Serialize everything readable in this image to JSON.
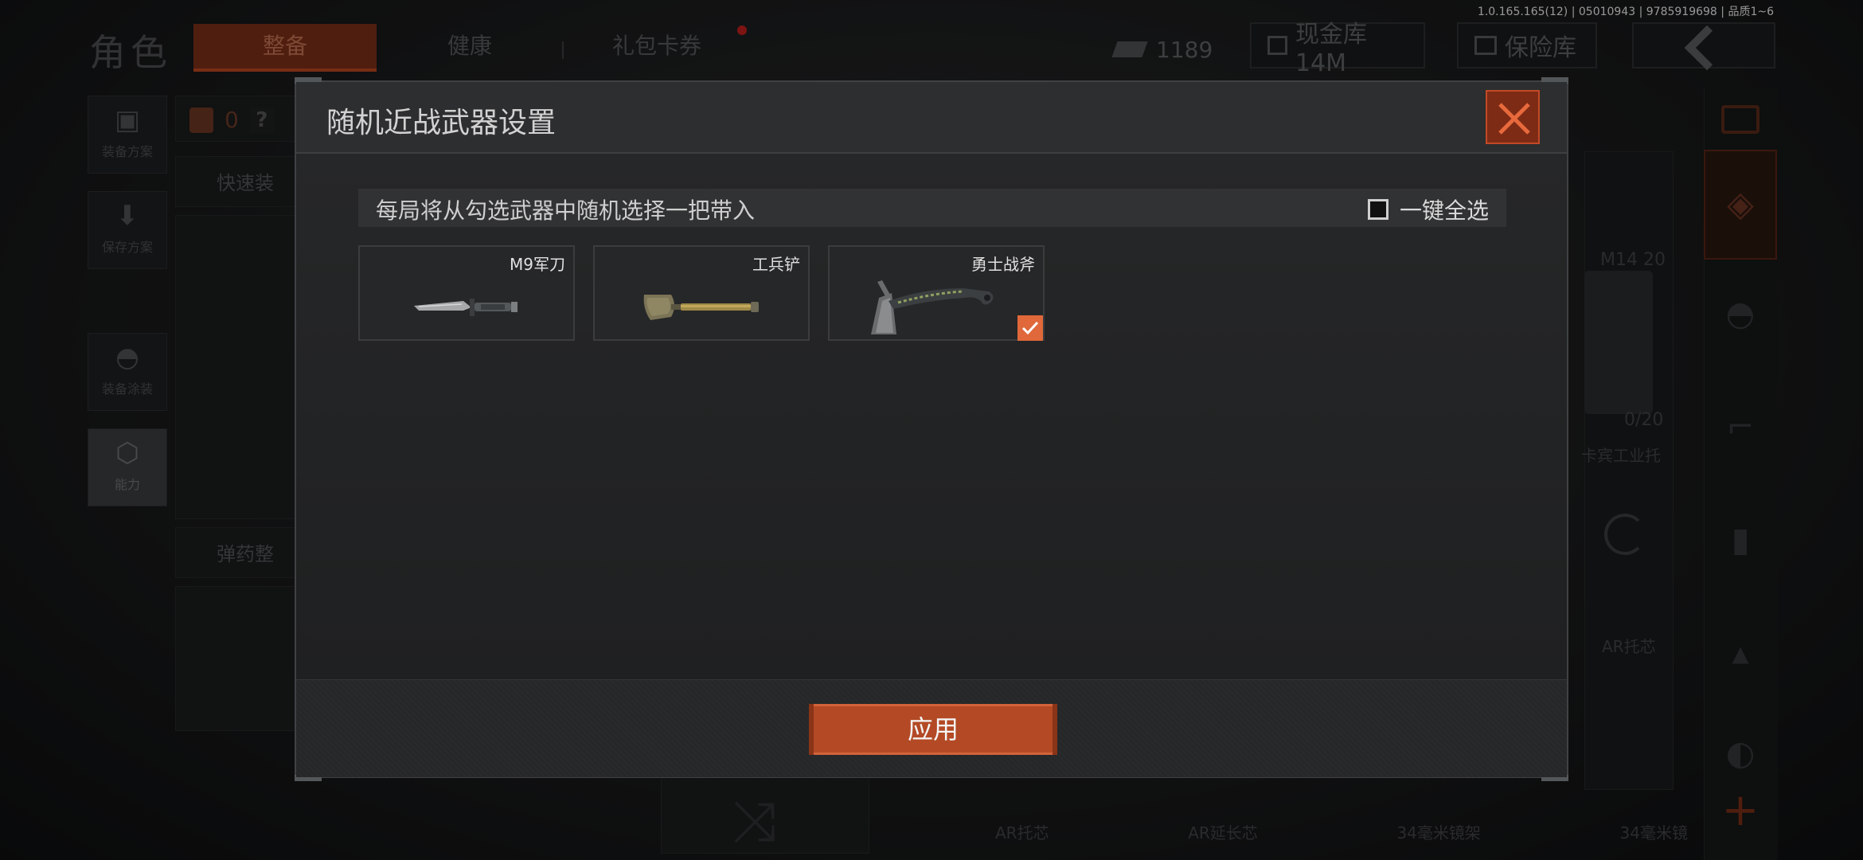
{
  "build_info": "1.0.165.165(12) | 05010943 | 9785919698 | 品质1~6",
  "header": {
    "title": "角色",
    "tabs": [
      {
        "label": "整备",
        "active": true
      },
      {
        "label": "健康",
        "active": false
      },
      {
        "label": "礼包卡券",
        "active": false
      }
    ],
    "currency": "1189",
    "cash_vault": "现金库 14M",
    "safe_box": "保险库"
  },
  "left_nav": [
    {
      "label": "装备方案",
      "icon": "vest-icon"
    },
    {
      "label": "保存方案",
      "icon": "download-icon"
    },
    {
      "label": "装备涂装",
      "icon": "helmet-icon"
    },
    {
      "label": "能力",
      "icon": "ability-icon",
      "active": true
    }
  ],
  "loadout": {
    "armor_count": "0",
    "help": "?",
    "quick_equip": "快速装",
    "ammo_config": "弹药整"
  },
  "attachments": {
    "mag_name": "M14 20",
    "mag_count": "0/20",
    "stock_name": "卡宾工业托",
    "buffer_name": "AR托芯",
    "bottom_items": [
      "AR托芯",
      "AR延长芯",
      "34毫米镜架",
      "34毫米镜"
    ]
  },
  "modal": {
    "title": "随机近战武器设置",
    "hint": "每局将从勾选武器中随机选择一把带入",
    "select_all_label": "一键全选",
    "select_all_checked": false,
    "weapons": [
      {
        "name": "M9军刀",
        "checked": false,
        "icon": "bayonet-icon"
      },
      {
        "name": "工兵铲",
        "checked": false,
        "icon": "shovel-icon"
      },
      {
        "name": "勇士战斧",
        "checked": true,
        "icon": "tomahawk-icon"
      }
    ],
    "apply_label": "应用"
  },
  "colors": {
    "accent": "#e0683a",
    "accent_dark": "#b34a25",
    "modal_bg": "#222324"
  }
}
